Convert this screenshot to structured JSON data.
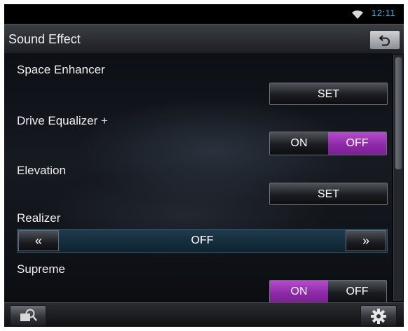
{
  "status_bar": {
    "time": "12:11",
    "wifi_icon": "wifi-icon"
  },
  "header": {
    "title": "Sound Effect",
    "back_icon": "back-arrow-icon"
  },
  "settings": {
    "space_enhancer": {
      "label": "Space Enhancer",
      "button": "SET"
    },
    "drive_equalizer": {
      "label": "Drive Equalizer +",
      "on": "ON",
      "off": "OFF",
      "selected": "OFF"
    },
    "elevation": {
      "label": "Elevation",
      "button": "SET"
    },
    "realizer": {
      "label": "Realizer",
      "prev": "«",
      "value": "OFF",
      "next": "»"
    },
    "supreme": {
      "label": "Supreme",
      "on": "ON",
      "off": "OFF",
      "selected": "ON"
    }
  },
  "footer": {
    "left_icon": "speaker-search-icon",
    "right_icon": "gear-icon"
  },
  "colors": {
    "accent": "#9b36b8",
    "clock": "#37b9e6"
  }
}
